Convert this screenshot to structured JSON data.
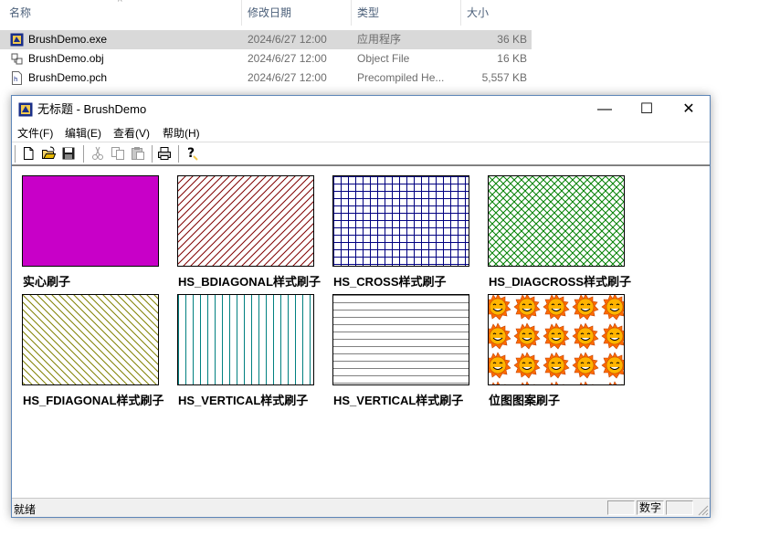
{
  "explorer": {
    "columns": {
      "name": "名称",
      "date": "修改日期",
      "type": "类型",
      "size": "大小"
    },
    "files": [
      {
        "name": "BrushDemo.exe",
        "date": "2024/6/27 12:00",
        "type": "应用程序",
        "size": "36 KB",
        "selected": true
      },
      {
        "name": "BrushDemo.obj",
        "date": "2024/6/27 12:00",
        "type": "Object File",
        "size": "16 KB"
      },
      {
        "name": "BrushDemo.pch",
        "date": "2024/6/27 12:00",
        "type": "Precompiled He...",
        "size": "5,557 KB"
      }
    ]
  },
  "window": {
    "title": "无标题 - BrushDemo",
    "controls": {
      "minimize": "—",
      "maximize": "☐",
      "close": "✕"
    },
    "menu": [
      "文件(F)",
      "编辑(E)",
      "查看(V)",
      "帮助(H)"
    ],
    "toolbar": [
      "new-icon",
      "open-icon",
      "save-icon",
      "cut-icon",
      "copy-icon",
      "paste-icon",
      "print-icon",
      "help-icon"
    ],
    "brushes": [
      {
        "label": "实心刷子",
        "pattern": "solid",
        "color": "#c800c8"
      },
      {
        "label": "HS_BDIAGONAL样式刷子",
        "pattern": "bdiagonal",
        "color": "#800000"
      },
      {
        "label": "HS_CROSS样式刷子",
        "pattern": "cross",
        "color": "#000080"
      },
      {
        "label": "HS_DIAGCROSS样式刷子",
        "pattern": "diagcross",
        "color": "#008000"
      },
      {
        "label": "HS_FDIAGONAL样式刷子",
        "pattern": "fdiagonal",
        "color": "#808000"
      },
      {
        "label": "HS_VERTICAL样式刷子",
        "pattern": "vertical",
        "color": "#008080"
      },
      {
        "label": "HS_VERTICAL样式刷子",
        "pattern": "horizontal",
        "color": "#808080"
      },
      {
        "label": "位图图案刷子",
        "pattern": "bitmap",
        "color": "#ff8c00"
      }
    ],
    "status": {
      "ready": "就绪",
      "num": "数字"
    }
  }
}
